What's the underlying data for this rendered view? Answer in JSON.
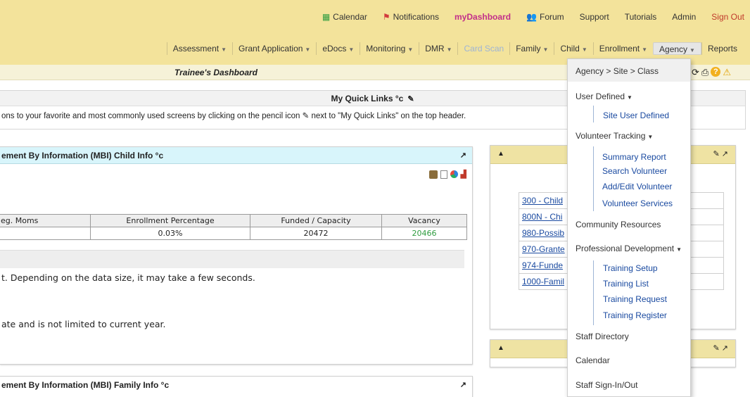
{
  "utility": {
    "calendar": "Calendar",
    "notifications": "Notifications",
    "dashboard": "myDashboard",
    "forum": "Forum",
    "support": "Support",
    "tutorials": "Tutorials",
    "admin": "Admin",
    "signout": "Sign Out"
  },
  "nav": [
    {
      "label": "Assessment",
      "caret": true
    },
    {
      "label": "Grant Application",
      "caret": true
    },
    {
      "label": "eDocs",
      "caret": true
    },
    {
      "label": "Monitoring",
      "caret": true
    },
    {
      "label": "DMR",
      "caret": true
    },
    {
      "label": "Card Scan",
      "caret": false
    },
    {
      "label": "Family",
      "caret": true
    },
    {
      "label": "Child",
      "caret": true
    },
    {
      "label": "Enrollment",
      "caret": true
    },
    {
      "label": "Agency",
      "caret": true
    },
    {
      "label": "Reports",
      "caret": false
    }
  ],
  "dashboard_title": "Trainee's Dashboard",
  "quick_links": {
    "title": "My Quick Links °c",
    "text": "ons to your favorite and most commonly used screens by clicking on the pencil icon ✎ next to \"My Quick Links\" on the top header."
  },
  "panel1": {
    "title": "ement By Information (MBI) Child Info °c",
    "columns": [
      "eg. Moms",
      "Enrollment Percentage",
      "Funded / Capacity",
      "Vacancy"
    ],
    "row": [
      "",
      "0.03%",
      "20472",
      "20466"
    ],
    "message1": "t. Depending on the data size, it may take a few seconds.",
    "message2": "ate and is not limited to current year."
  },
  "panel2": {
    "title": "ement By Information (MBI) Family Info °c"
  },
  "right_links": [
    "300 - Child",
    "800N - Chi",
    "980-Possib",
    "970-Grante",
    "974-Funde",
    "1000-Famil"
  ],
  "agency_menu": {
    "top": "Agency > Site > Class",
    "user_defined": "User Defined",
    "site_user_defined": "Site User Defined",
    "volunteer_tracking": "Volunteer Tracking",
    "volunteer_items": [
      "Summary Report",
      "Search Volunteer",
      "Add/Edit Volunteer",
      "Volunteer Services"
    ],
    "community_resources": "Community Resources",
    "professional_development": "Professional Development",
    "training_items": [
      "Training Setup",
      "Training List",
      "Training Request",
      "Training Register"
    ],
    "staff_directory": "Staff Directory",
    "calendar": "Calendar",
    "staff_sign": "Staff Sign-In/Out"
  },
  "colors": {
    "topbar": "#f3e39b",
    "panel_header_cyan": "#d8f5fb",
    "right_header": "#efe3a3",
    "link_blue": "#1a4aa0",
    "vacancy_green": "#2e9c3f",
    "signout_red": "#c0392b",
    "dashboard_magenta": "#c22f8a"
  }
}
